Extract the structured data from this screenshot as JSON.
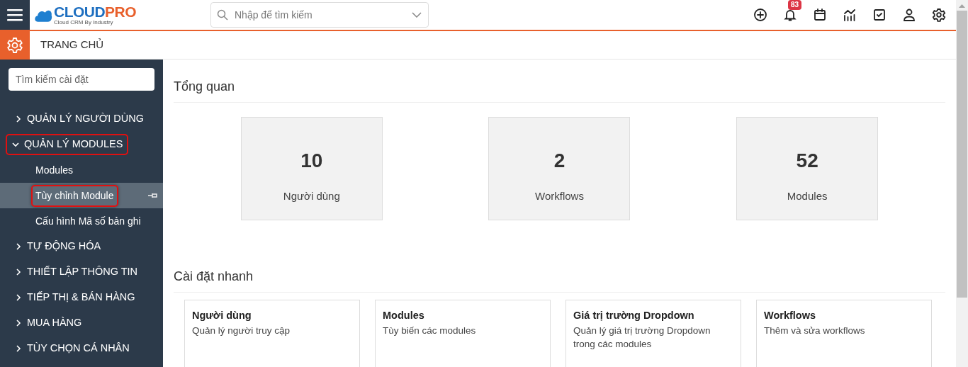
{
  "logo": {
    "brand_a": "CLOUD",
    "brand_b": "PRO",
    "tagline": "Cloud CRM By Industry"
  },
  "search": {
    "placeholder": "Nhập để tìm kiếm"
  },
  "toolbar": [
    {
      "kind": "add"
    },
    {
      "kind": "bell",
      "badge": "83"
    },
    {
      "kind": "calendar"
    },
    {
      "kind": "chart"
    },
    {
      "kind": "task"
    },
    {
      "kind": "user"
    },
    {
      "kind": "settings"
    }
  ],
  "breadcrumb": "TRANG CHỦ",
  "sidebar": {
    "search_placeholder": "Tìm kiếm cài đặt",
    "items": [
      {
        "label": "QUẢN LÝ NGƯỜI DÙNG",
        "expanded": false,
        "highlighted": false
      },
      {
        "label": "QUẢN LÝ MODULES",
        "expanded": true,
        "highlighted": true,
        "children": [
          {
            "label": "Modules",
            "selected": false,
            "highlighted": false
          },
          {
            "label": "Tùy chỉnh Module",
            "selected": true,
            "highlighted": true
          },
          {
            "label": "Cấu hình Mã số bản ghi",
            "selected": false,
            "highlighted": false
          }
        ]
      },
      {
        "label": "TỰ ĐỘNG HÓA",
        "expanded": false,
        "highlighted": false
      },
      {
        "label": "THIẾT LẬP THÔNG TIN",
        "expanded": false,
        "highlighted": false
      },
      {
        "label": "TIẾP THỊ & BÁN HÀNG",
        "expanded": false,
        "highlighted": false
      },
      {
        "label": "MUA HÀNG",
        "expanded": false,
        "highlighted": false
      },
      {
        "label": "TÙY CHỌN CÁ NHÂN",
        "expanded": false,
        "highlighted": false
      }
    ]
  },
  "overview": {
    "title": "Tổng quan",
    "stats": [
      {
        "value": "10",
        "label": "Người dùng"
      },
      {
        "value": "2",
        "label": "Workflows"
      },
      {
        "value": "52",
        "label": "Modules"
      }
    ]
  },
  "quick_settings": {
    "title": "Cài đặt nhanh",
    "cards": [
      {
        "title": "Người dùng",
        "description": "Quản lý người truy cập"
      },
      {
        "title": "Modules",
        "description": "Tùy biến các modules"
      },
      {
        "title": "Giá trị trường Dropdown",
        "description": "Quản lý giá trị trường Dropdown trong các modules"
      },
      {
        "title": "Workflows",
        "description": "Thêm và sửa workflows"
      }
    ]
  }
}
